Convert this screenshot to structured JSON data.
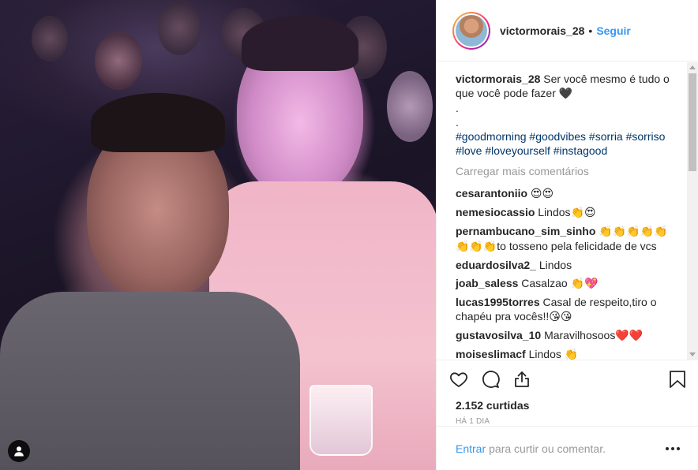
{
  "post": {
    "username": "victormorais_28",
    "dot": "•",
    "follow_label": "Seguir",
    "caption": {
      "username": "victormorais_28",
      "text": "Ser você mesmo é tudo o que você pode fazer",
      "emoji": "🖤",
      "line2": ".",
      "line3": ".",
      "hashtags": [
        "#goodmorning",
        "#goodvibes",
        "#sorria",
        "#sorriso",
        "#love",
        "#loveyourself",
        "#instagood"
      ]
    },
    "load_more": "Carregar mais comentários",
    "comments": [
      {
        "user": "cesarantoniio",
        "text": "",
        "emoji": "😍😍"
      },
      {
        "user": "nemesiocassio",
        "text": "Lindos",
        "emoji": "👏😍"
      },
      {
        "user": "pernambucano_sim_sinho",
        "text": "",
        "emoji": "👏👏👏👏👏",
        "emoji2": "👏👏👏",
        "text2": "to tosseno pela felicidade de vcs"
      },
      {
        "user": "eduardosilva2_",
        "text": "Lindos",
        "emoji": ""
      },
      {
        "user": "joab_saless",
        "text": "Casalzao",
        "emoji": "👏💖"
      },
      {
        "user": "lucas1995torres",
        "text": "Casal de respeito,tiro o chapéu pra vocês!!",
        "emoji": "😘😘"
      },
      {
        "user": "gustavosilva_10",
        "text": "Maravilhosoos",
        "emoji": "❤️❤️"
      },
      {
        "user": "moiseslimacf",
        "text": "Lindos",
        "emoji": "👏"
      }
    ],
    "likes_count": "2.152 curtidas",
    "time_ago": "HÁ 1 DIA",
    "add_comment": {
      "login_link": "Entrar",
      "text": "para curtir ou comentar."
    }
  },
  "icons": {
    "like": "heart-icon",
    "comment": "comment-icon",
    "share": "share-icon",
    "save": "bookmark-icon",
    "user_tags": "user-icon",
    "options": "more-options-icon"
  },
  "colors": {
    "link": "#3897f0",
    "hashtag": "#003569",
    "muted": "#999999",
    "text": "#262626"
  }
}
